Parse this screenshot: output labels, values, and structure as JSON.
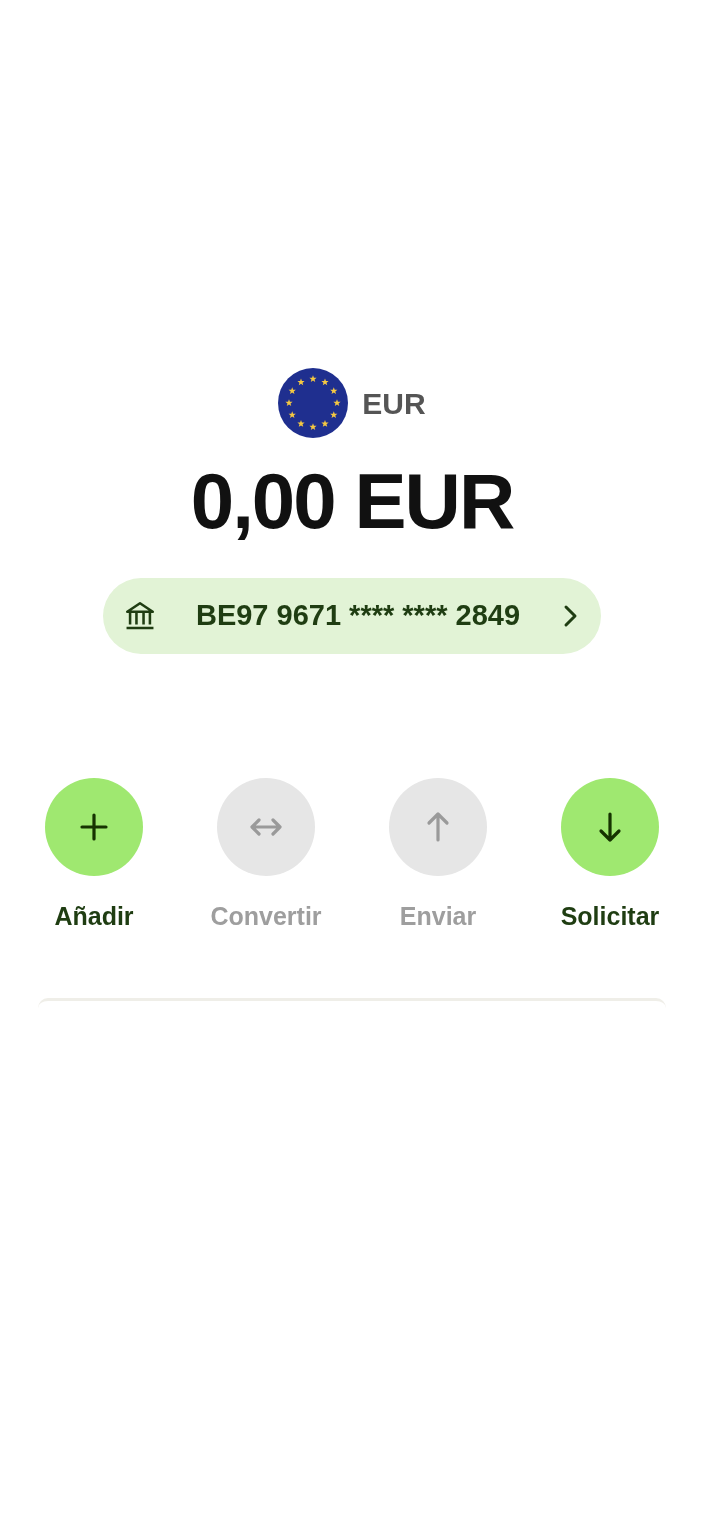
{
  "currency": {
    "code": "EUR"
  },
  "balance": "0,00 EUR",
  "account": {
    "iban": "BE97 9671 **** **** 2849"
  },
  "actions": [
    {
      "label": "Añadir",
      "kind": "add",
      "disabled": false
    },
    {
      "label": "Convertir",
      "kind": "convert",
      "disabled": true
    },
    {
      "label": "Enviar",
      "kind": "send",
      "disabled": true
    },
    {
      "label": "Solicitar",
      "kind": "request",
      "disabled": false
    }
  ]
}
